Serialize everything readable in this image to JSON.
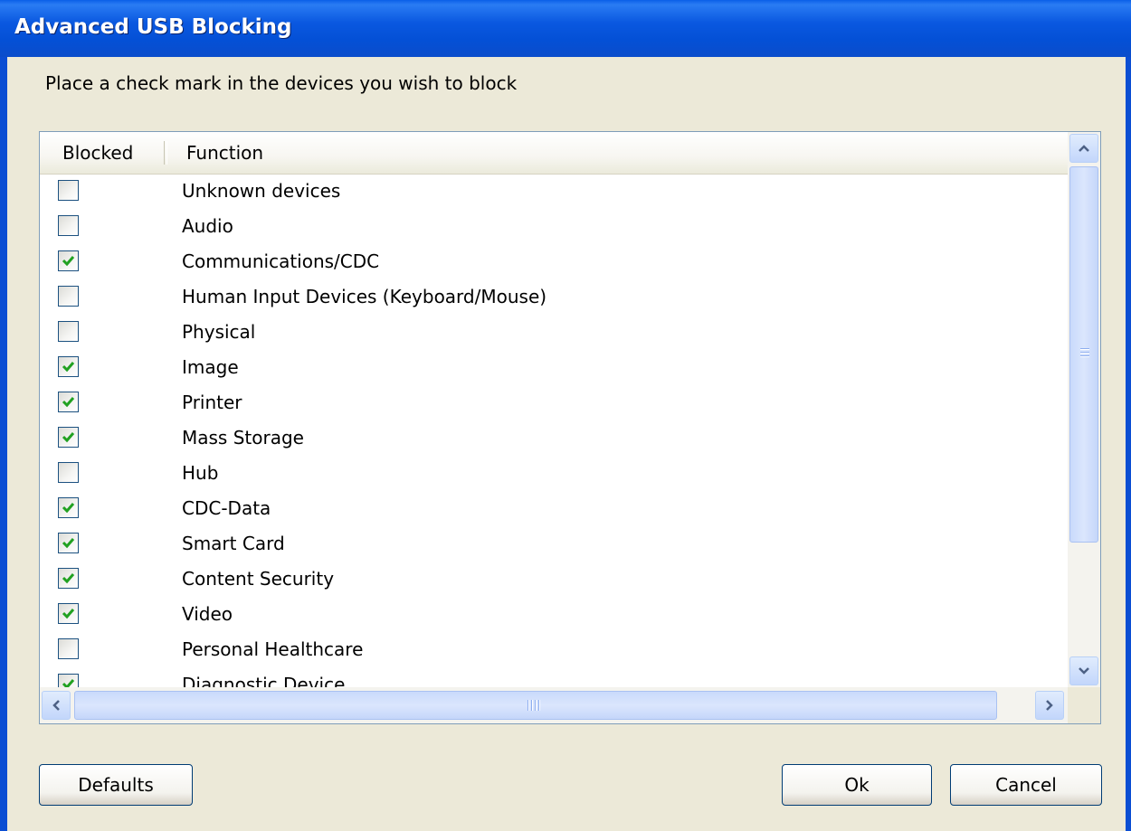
{
  "window": {
    "title": "Advanced USB Blocking"
  },
  "instruction": "Place a check mark in the devices you wish to block",
  "columns": {
    "blocked": "Blocked",
    "function": "Function"
  },
  "devices": [
    {
      "name": "Unknown devices",
      "blocked": false
    },
    {
      "name": "Audio",
      "blocked": false
    },
    {
      "name": "Communications/CDC",
      "blocked": true
    },
    {
      "name": "Human Input Devices (Keyboard/Mouse)",
      "blocked": false
    },
    {
      "name": "Physical",
      "blocked": false
    },
    {
      "name": "Image",
      "blocked": true
    },
    {
      "name": "Printer",
      "blocked": true
    },
    {
      "name": "Mass Storage",
      "blocked": true
    },
    {
      "name": "Hub",
      "blocked": false
    },
    {
      "name": "CDC-Data",
      "blocked": true
    },
    {
      "name": "Smart Card",
      "blocked": true
    },
    {
      "name": "Content Security",
      "blocked": true
    },
    {
      "name": "Video",
      "blocked": true
    },
    {
      "name": "Personal Healthcare",
      "blocked": false
    },
    {
      "name": "Diagnostic Device",
      "blocked": true
    }
  ],
  "buttons": {
    "defaults": "Defaults",
    "ok": "Ok",
    "cancel": "Cancel"
  },
  "colors": {
    "check": "#21a121",
    "titlebar": "#0a58e0",
    "scroll_arrow": "#4d6185"
  }
}
